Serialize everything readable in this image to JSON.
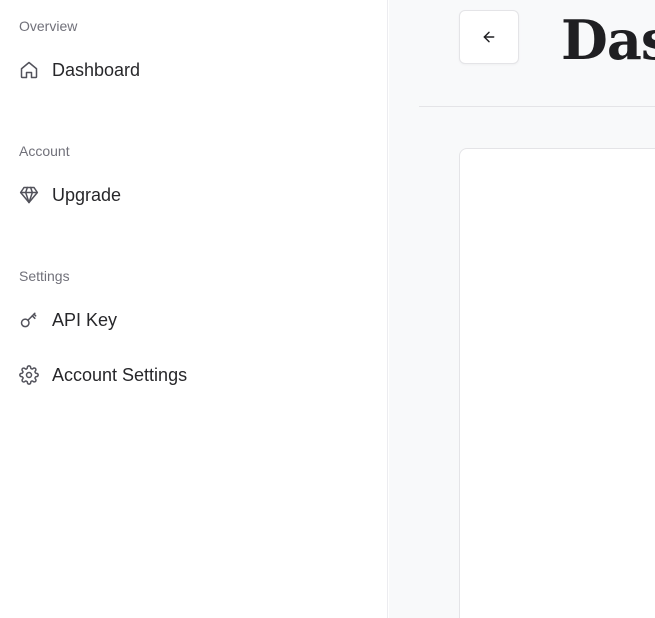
{
  "sidebar": {
    "sections": [
      {
        "label": "Overview",
        "items": [
          {
            "label": "Dashboard",
            "icon": "home-icon"
          }
        ]
      },
      {
        "label": "Account",
        "items": [
          {
            "label": "Upgrade",
            "icon": "diamond-icon"
          }
        ]
      },
      {
        "label": "Settings",
        "items": [
          {
            "label": "API Key",
            "icon": "key-icon"
          },
          {
            "label": "Account Settings",
            "icon": "gear-icon"
          }
        ]
      }
    ]
  },
  "header": {
    "title": "Dashboard",
    "back_icon": "arrow-left-icon"
  },
  "colors": {
    "sidebar_bg": "#ffffff",
    "main_bg": "#f8f9fa",
    "text": "#27272a",
    "muted": "#71717a",
    "border": "#e4e4e7"
  }
}
